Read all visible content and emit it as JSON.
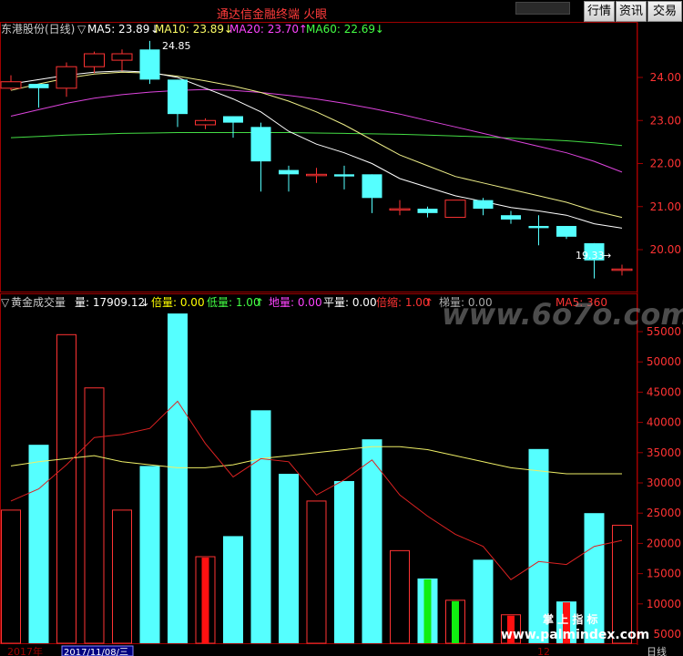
{
  "app": {
    "title": "通达信金融终端 火眼",
    "buttons": [
      "行情",
      "资讯",
      "交易"
    ]
  },
  "price_panel": {
    "stock_name": "东港股份(日线)",
    "indicators": [
      {
        "label": "MA5: 23.89",
        "arrow": "↓",
        "color": "#ffffff"
      },
      {
        "label": "MA10: 23.89",
        "arrow": "↓",
        "color": "#ffff66"
      },
      {
        "label": "MA20: 23.70",
        "arrow": "↑",
        "color": "#ff44ff"
      },
      {
        "label": "MA60: 22.69",
        "arrow": "↓",
        "color": "#44ff44"
      }
    ],
    "high_label": "24.85",
    "low_label": "19.33",
    "axis_ticks": [
      "24.00",
      "23.00",
      "22.00",
      "21.00",
      "20.00"
    ]
  },
  "volume_panel": {
    "title": "黄金成交量",
    "fields": [
      {
        "label": "量: 17909.12",
        "arrow": "↓",
        "color": "#ffffff"
      },
      {
        "label": "倍量: 0.00",
        "arrow": "",
        "color": "#ffff00"
      },
      {
        "label": "低量: 1.00",
        "arrow": "↑",
        "color": "#44ff44"
      },
      {
        "label": "地量: 0.00",
        "arrow": "",
        "color": "#ff44ff"
      },
      {
        "label": "平量: 0.00",
        "arrow": "",
        "color": "#ffffff"
      },
      {
        "label": "倍缩: 1.00",
        "arrow": "↑",
        "color": "#ff3333"
      },
      {
        "label": "梯量: 0.00",
        "arrow": "",
        "color": "#aaaaaa"
      },
      {
        "label": "MA5: 360",
        "arrow": "",
        "color": "#ff3333"
      }
    ],
    "axis_ticks": [
      "55000",
      "50000",
      "45000",
      "40000",
      "35000",
      "30000",
      "25000",
      "20000",
      "15000",
      "10000",
      "5000"
    ]
  },
  "bottom_bar": {
    "year": "2017年",
    "date": "2017/11/08/三",
    "month": "12",
    "period": "日线"
  },
  "watermarks": {
    "center": "www.6o7o.com",
    "bottom_cn": "掌 上 指 标",
    "bottom_url": "www.palmindex.com"
  },
  "chart_data": {
    "type": "candlestick",
    "price_ylim": [
      19.2,
      25.0
    ],
    "volume_ylim": [
      0,
      58000
    ],
    "candles": [
      {
        "o": 23.75,
        "h": 24.05,
        "l": 23.7,
        "c": 23.9,
        "up": true
      },
      {
        "o": 23.75,
        "h": 23.85,
        "l": 23.3,
        "c": 23.85,
        "up": false
      },
      {
        "o": 23.75,
        "h": 24.35,
        "l": 23.55,
        "c": 24.25,
        "up": true
      },
      {
        "o": 24.25,
        "h": 24.6,
        "l": 24.1,
        "c": 24.55,
        "up": true
      },
      {
        "o": 24.4,
        "h": 24.65,
        "l": 24.15,
        "c": 24.55,
        "up": true
      },
      {
        "o": 24.65,
        "h": 24.85,
        "l": 23.85,
        "c": 23.95,
        "up": false
      },
      {
        "o": 23.95,
        "h": 23.95,
        "l": 22.85,
        "c": 23.15,
        "up": false
      },
      {
        "o": 22.9,
        "h": 23.05,
        "l": 22.8,
        "c": 23.0,
        "up": true
      },
      {
        "o": 23.1,
        "h": 23.1,
        "l": 22.6,
        "c": 22.95,
        "up": false
      },
      {
        "o": 22.85,
        "h": 22.95,
        "l": 21.35,
        "c": 22.05,
        "up": false
      },
      {
        "o": 21.85,
        "h": 21.95,
        "l": 21.35,
        "c": 21.75,
        "up": false
      },
      {
        "o": 21.75,
        "h": 21.9,
        "l": 21.55,
        "c": 21.75,
        "up": true
      },
      {
        "o": 21.75,
        "h": 21.95,
        "l": 21.4,
        "c": 21.7,
        "up": false
      },
      {
        "o": 21.75,
        "h": 21.75,
        "l": 20.85,
        "c": 21.2,
        "up": false
      },
      {
        "o": 20.95,
        "h": 21.15,
        "l": 20.8,
        "c": 20.95,
        "up": true
      },
      {
        "o": 20.95,
        "h": 21.0,
        "l": 20.75,
        "c": 20.85,
        "up": false
      },
      {
        "o": 21.15,
        "h": 21.15,
        "l": 20.75,
        "c": 20.75,
        "up": true
      },
      {
        "o": 21.15,
        "h": 21.2,
        "l": 20.8,
        "c": 20.95,
        "up": false
      },
      {
        "o": 20.8,
        "h": 20.9,
        "l": 20.6,
        "c": 20.7,
        "up": false
      },
      {
        "o": 20.55,
        "h": 20.8,
        "l": 20.1,
        "c": 20.5,
        "up": false
      },
      {
        "o": 20.55,
        "h": 20.55,
        "l": 20.25,
        "c": 20.3,
        "up": false
      },
      {
        "o": 20.15,
        "h": 20.15,
        "l": 19.33,
        "c": 19.75,
        "up": false
      },
      {
        "o": 19.55,
        "h": 19.65,
        "l": 19.4,
        "c": 19.55,
        "up": true
      }
    ],
    "volume": [
      {
        "v": 25500,
        "up": true,
        "red_fill": false
      },
      {
        "v": 36300,
        "up": false,
        "red_fill": false
      },
      {
        "v": 54500,
        "up": true,
        "red_fill": false
      },
      {
        "v": 45700,
        "up": true,
        "red_fill": false
      },
      {
        "v": 25500,
        "up": true,
        "red_fill": false
      },
      {
        "v": 32800,
        "up": false,
        "red_fill": false
      },
      {
        "v": 58000,
        "up": false,
        "red_fill": false
      },
      {
        "v": 17800,
        "up": true,
        "red_fill": true
      },
      {
        "v": 21200,
        "up": false,
        "red_fill": false
      },
      {
        "v": 42000,
        "up": false,
        "red_fill": false
      },
      {
        "v": 31500,
        "up": false,
        "red_fill": false
      },
      {
        "v": 27000,
        "up": true,
        "red_fill": false
      },
      {
        "v": 30300,
        "up": false,
        "red_fill": false
      },
      {
        "v": 37200,
        "up": false,
        "red_fill": false
      },
      {
        "v": 18800,
        "up": true,
        "red_fill": false
      },
      {
        "v": 14200,
        "up": false,
        "green_fill": true
      },
      {
        "v": 10600,
        "up": true,
        "green_fill": true
      },
      {
        "v": 17300,
        "up": false,
        "red_fill": false
      },
      {
        "v": 8200,
        "up": true,
        "red_fill": true
      },
      {
        "v": 35600,
        "up": false,
        "red_fill": false
      },
      {
        "v": 10400,
        "up": false,
        "red_fill": true
      },
      {
        "v": 25000,
        "up": false,
        "red_fill": false
      },
      {
        "v": 23000,
        "up": true,
        "red_fill": false
      }
    ],
    "ma5": [
      23.85,
      23.95,
      24.05,
      24.12,
      24.15,
      24.12,
      24.0,
      23.75,
      23.5,
      23.2,
      22.75,
      22.45,
      22.25,
      22.0,
      21.65,
      21.45,
      21.25,
      21.12,
      20.98,
      20.9,
      20.8,
      20.6,
      20.5
    ],
    "ma10": [
      23.7,
      23.85,
      23.98,
      24.08,
      24.12,
      24.1,
      24.03,
      23.92,
      23.8,
      23.65,
      23.45,
      23.2,
      22.9,
      22.55,
      22.2,
      21.95,
      21.7,
      21.55,
      21.4,
      21.25,
      21.1,
      20.9,
      20.75
    ],
    "ma20": [
      23.1,
      23.25,
      23.4,
      23.52,
      23.6,
      23.66,
      23.7,
      23.72,
      23.7,
      23.65,
      23.58,
      23.5,
      23.4,
      23.28,
      23.15,
      23.0,
      22.85,
      22.7,
      22.55,
      22.4,
      22.25,
      22.05,
      21.8
    ],
    "ma60": [
      22.6,
      22.63,
      22.66,
      22.68,
      22.7,
      22.71,
      22.72,
      22.72,
      22.72,
      22.72,
      22.72,
      22.71,
      22.7,
      22.69,
      22.68,
      22.66,
      22.64,
      22.62,
      22.59,
      22.56,
      22.53,
      22.48,
      22.42
    ],
    "vol_ma_yellow": [
      32800,
      33500,
      34000,
      34500,
      33500,
      33000,
      32500,
      32500,
      33000,
      34000,
      34500,
      35000,
      35500,
      36000,
      36000,
      35500,
      34500,
      33500,
      32500,
      32000,
      31500,
      31500,
      31500
    ],
    "vol_ma_red": [
      27000,
      29000,
      33000,
      37500,
      38000,
      39000,
      43500,
      36500,
      31000,
      34000,
      33500,
      28000,
      30500,
      33800,
      28000,
      24500,
      21500,
      19500,
      14000,
      17000,
      16500,
      19500,
      20500
    ]
  }
}
